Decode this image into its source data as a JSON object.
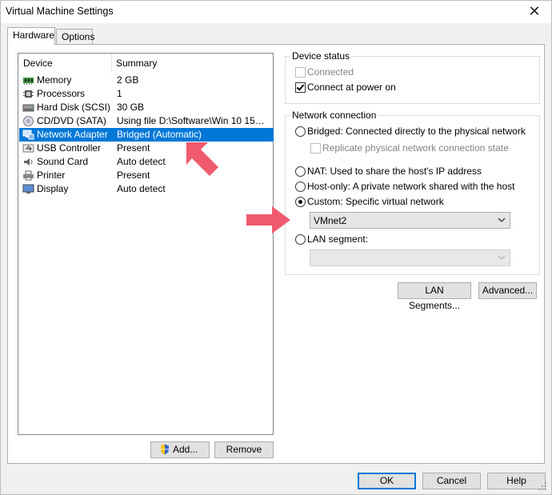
{
  "window": {
    "title": "Virtual Machine Settings",
    "close_glyph": "✕"
  },
  "tabs": [
    {
      "label": "Hardware",
      "active": true
    },
    {
      "label": "Options",
      "active": false
    }
  ],
  "device_list": {
    "columns": [
      "Device",
      "Summary"
    ],
    "rows": [
      {
        "icon": "memory-icon",
        "device": "Memory",
        "summary": "2 GB"
      },
      {
        "icon": "processor-icon",
        "device": "Processors",
        "summary": "1"
      },
      {
        "icon": "hard-disk-icon",
        "device": "Hard Disk (SCSI)",
        "summary": "30 GB"
      },
      {
        "icon": "cd-dvd-icon",
        "device": "CD/DVD (SATA)",
        "summary": "Using file D:\\Software\\Win 10 15025..."
      },
      {
        "icon": "network-adapter-icon",
        "device": "Network Adapter",
        "summary": "Bridged (Automatic)",
        "selected": true
      },
      {
        "icon": "usb-icon",
        "device": "USB Controller",
        "summary": "Present"
      },
      {
        "icon": "sound-card-icon",
        "device": "Sound Card",
        "summary": "Auto detect"
      },
      {
        "icon": "printer-icon",
        "device": "Printer",
        "summary": "Present"
      },
      {
        "icon": "display-icon",
        "device": "Display",
        "summary": "Auto detect"
      }
    ]
  },
  "list_buttons": {
    "add": "Add...",
    "remove": "Remove"
  },
  "device_status": {
    "title": "Device status",
    "connected": {
      "label": "Connected",
      "checked": false,
      "disabled": true
    },
    "connect_power_on": {
      "label": "Connect at power on",
      "checked": true
    }
  },
  "network_connection": {
    "title": "Network connection",
    "bridged": "Bridged: Connected directly to the physical network",
    "replicate": "Replicate physical network connection state",
    "nat": "NAT: Used to share the host's IP address",
    "host_only": "Host-only: A private network shared with the host",
    "custom": "Custom: Specific virtual network",
    "custom_selected": true,
    "vmnet_value": "VMnet2",
    "lan_segment": "LAN segment:"
  },
  "panel_buttons": {
    "lan_segments": "LAN Segments...",
    "advanced": "Advanced..."
  },
  "footer_buttons": {
    "ok": "OK",
    "cancel": "Cancel",
    "help": "Help"
  },
  "colors": {
    "selection": "#0078d7",
    "annotation_arrow": "#f05a6e"
  }
}
